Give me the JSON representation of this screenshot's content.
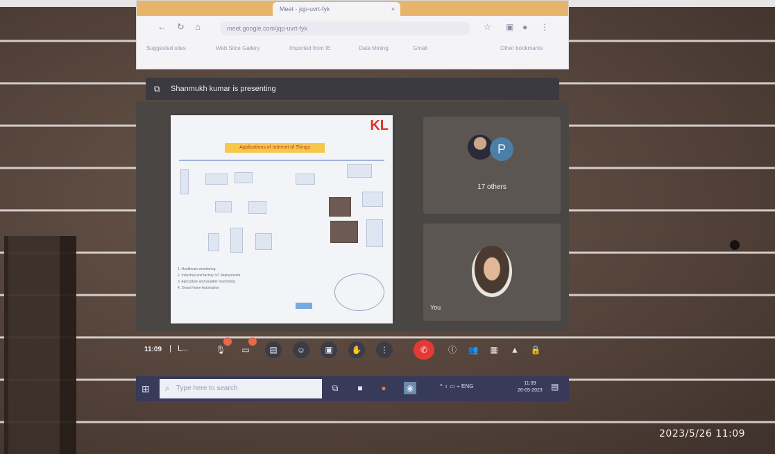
{
  "browser": {
    "tab_title": "Meet - jqp-uvrt-fyk",
    "tab_close": "×",
    "url": "meet.google.com/jqp-uvrt-fyk",
    "bookmarks": [
      "Suggested sites",
      "Web Slice Gallery",
      "Imported from IE",
      "Data Mining",
      "Gmail",
      "Other bookmarks"
    ]
  },
  "banner": {
    "text": "Shanmukh kumar is presenting"
  },
  "slide": {
    "logo": "KL",
    "title": "Applications of Internet of Things",
    "bullets": [
      "1. Healthcare monitoring",
      "2. Industrial and factory IoT deployments",
      "3. Agriculture and weather monitoring",
      "4. Smart Home Automation"
    ]
  },
  "participants": {
    "others_avatar_letter": "P",
    "others_label": "17 others",
    "self_label": "You"
  },
  "controls": {
    "time": "11:09",
    "separator": "|",
    "meeting_code": "L..."
  },
  "taskbar": {
    "search_placeholder": "Type here to search",
    "tray_text": "ENG",
    "time": "11:09",
    "date": "26-05-2023"
  },
  "photo_timestamp": "2023/5/26 11:09"
}
